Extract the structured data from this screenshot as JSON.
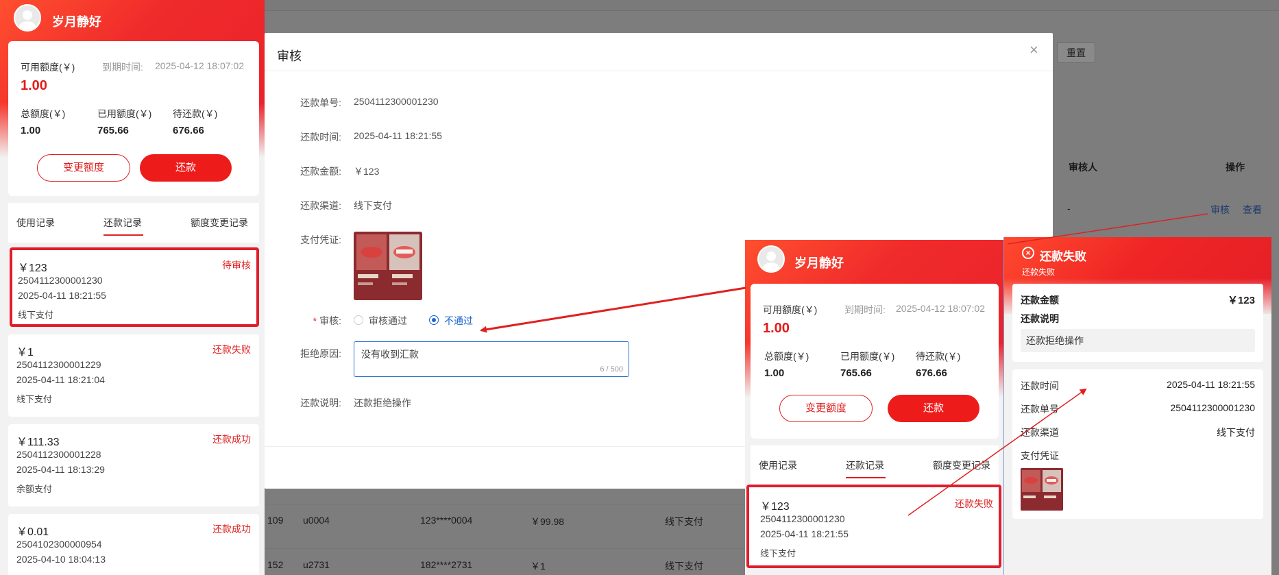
{
  "background": {
    "reset_label": "重置",
    "columns": {
      "auditor": "审核人",
      "operation": "操作"
    },
    "first_row": {
      "auditor": "-",
      "audit_link": "审核",
      "view_link": "查看"
    },
    "rows": [
      {
        "id": "109",
        "user": "u0004",
        "phone": "123****0004",
        "amount": "￥99.98",
        "channel": "线下支付"
      },
      {
        "id": "152",
        "user": "u2731",
        "phone": "182****2731",
        "amount": "￥1",
        "channel": "线下支付"
      }
    ]
  },
  "modal": {
    "title": "审核",
    "close": "×",
    "fields": {
      "order_no_label": "还款单号:",
      "order_no": "2504112300001230",
      "time_label": "还款时间:",
      "time": "2025-04-11 18:21:55",
      "amount_label": "还款金额:",
      "amount": "￥123",
      "channel_label": "还款渠道:",
      "channel": "线下支付",
      "voucher_label": "支付凭证:",
      "audit_required": "*",
      "audit_label": "审核:",
      "option_pass": "审核通过",
      "option_reject": "不通过",
      "reason_label": "拒绝原因:",
      "reason_value": "没有收到汇款",
      "reason_count": "6 / 500",
      "desc_label": "还款说明:",
      "desc_value": "还款拒绝操作"
    }
  },
  "phone_left": {
    "user_name": "岁月静好",
    "available_label": "可用额度(￥)",
    "expire_label": "到期时间:",
    "expire_value": "2025-04-12 18:07:02",
    "available_value": "1.00",
    "total_label": "总额度(￥)",
    "total_value": "1.00",
    "used_label": "已用额度(￥)",
    "used_value": "765.66",
    "pending_label": "待还款(￥)",
    "pending_value": "676.66",
    "change_btn": "变更额度",
    "repay_btn": "还款",
    "tabs": [
      "使用记录",
      "还款记录",
      "额度变更记录"
    ],
    "records": [
      {
        "amount": "￥123",
        "no": "2504112300001230",
        "time": "2025-04-11 18:21:55",
        "channel": "线下支付",
        "status": "待审核"
      },
      {
        "amount": "￥1",
        "no": "2504112300001229",
        "time": "2025-04-11 18:21:04",
        "channel": "线下支付",
        "status": "还款失败"
      },
      {
        "amount": "￥111.33",
        "no": "2504112300001228",
        "time": "2025-04-11 18:13:29",
        "channel": "余额支付",
        "status": "还款成功"
      },
      {
        "amount": "￥0.01",
        "no": "2504102300000954",
        "time": "2025-04-10 18:04:13",
        "channel": "",
        "status": "还款成功"
      }
    ]
  },
  "phone_mid": {
    "user_name": "岁月静好",
    "available_label": "可用额度(￥)",
    "expire_label": "到期时间:",
    "expire_value": "2025-04-12 18:07:02",
    "available_value": "1.00",
    "total_label": "总额度(￥)",
    "total_value": "1.00",
    "used_label": "已用额度(￥)",
    "used_value": "765.66",
    "pending_label": "待还款(￥)",
    "pending_value": "676.66",
    "change_btn": "变更额度",
    "repay_btn": "还款",
    "tabs": [
      "使用记录",
      "还款记录",
      "额度变更记录"
    ],
    "record": {
      "amount": "￥123",
      "no": "2504112300001230",
      "time": "2025-04-11 18:21:55",
      "channel": "线下支付",
      "status": "还款失败"
    }
  },
  "detail": {
    "title": "还款失败",
    "subtitle": "还款失败",
    "amount_label": "还款金额",
    "amount_value": "￥123",
    "desc_label": "还款说明",
    "desc_value": "还款拒绝操作",
    "time_label": "还款时间",
    "time_value": "2025-04-11 18:21:55",
    "no_label": "还款单号",
    "no_value": "2504112300001230",
    "channel_label": "还款渠道",
    "channel_value": "线下支付",
    "voucher_label": "支付凭证"
  },
  "colors": {
    "brand_red": "#e02020",
    "link_blue": "#1c64d4",
    "highlight_red": "#e11d2c"
  }
}
